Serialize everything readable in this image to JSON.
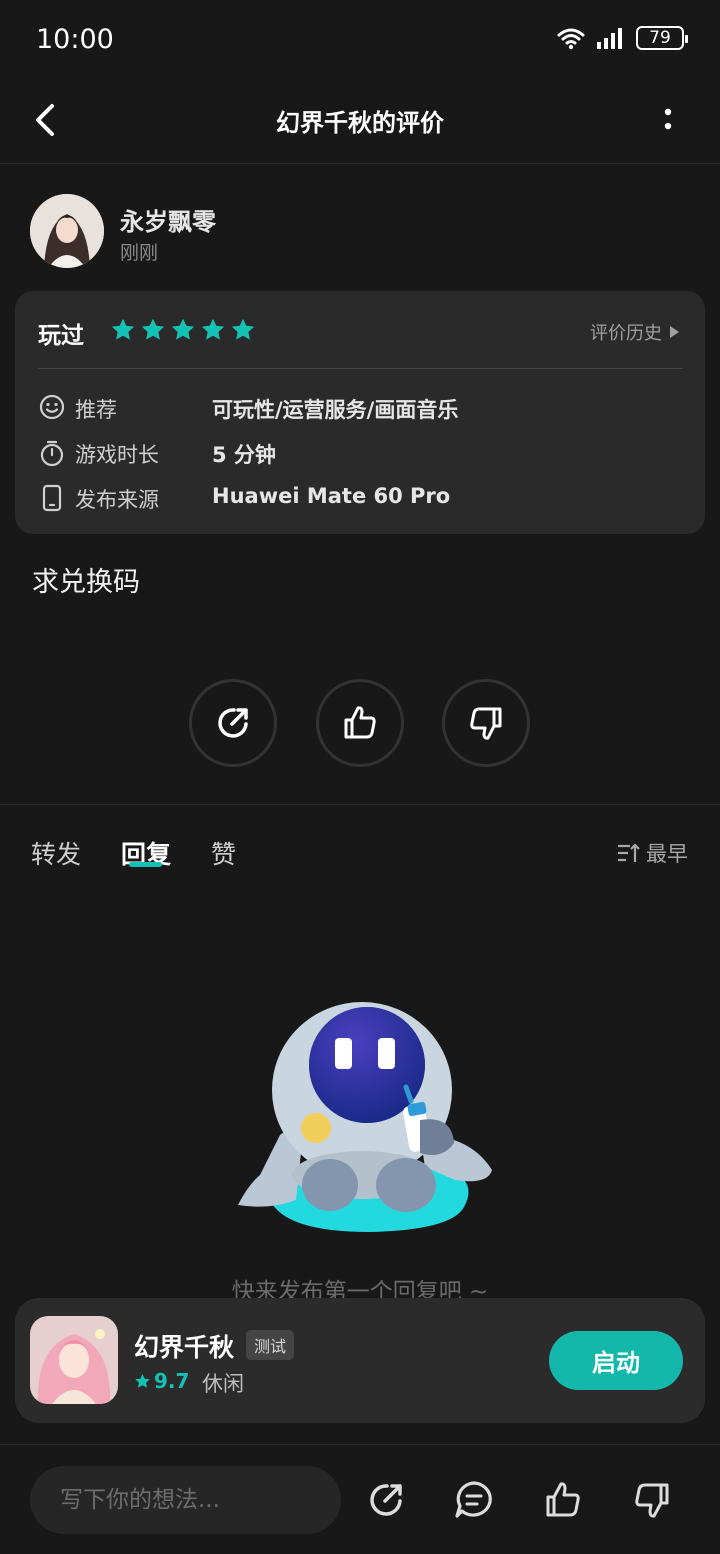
{
  "status_bar": {
    "time": "10:00",
    "battery": "79"
  },
  "header": {
    "title": "幻界千秋的评价"
  },
  "user": {
    "name": "永岁飘零",
    "time": "刚刚"
  },
  "review": {
    "status": "玩过",
    "rating": 5,
    "history_label": "评价历史",
    "rows": [
      {
        "label": "推荐",
        "value": "可玩性/运营服务/画面音乐",
        "icon": "smile-icon"
      },
      {
        "label": "游戏时长",
        "value": "5 分钟",
        "icon": "stopwatch-icon"
      },
      {
        "label": "发布来源",
        "value": "Huawei Mate 60 Pro",
        "icon": "phone-icon"
      }
    ],
    "text": "求兑换码"
  },
  "tabs": [
    {
      "label": "转发",
      "active": false
    },
    {
      "label": "回复",
      "active": true
    },
    {
      "label": "赞",
      "active": false
    }
  ],
  "sort_label": "最早",
  "empty_text": "快来发布第一个回复吧 ~",
  "game": {
    "name": "幻界千秋",
    "tag": "测试",
    "score": "9.7",
    "genre": "休闲",
    "launch_label": "启动"
  },
  "bottom_bar": {
    "placeholder": "写下你的想法..."
  },
  "colors": {
    "accent": "#14c1b5",
    "background": "#181818",
    "card": "#2a2a2a"
  }
}
